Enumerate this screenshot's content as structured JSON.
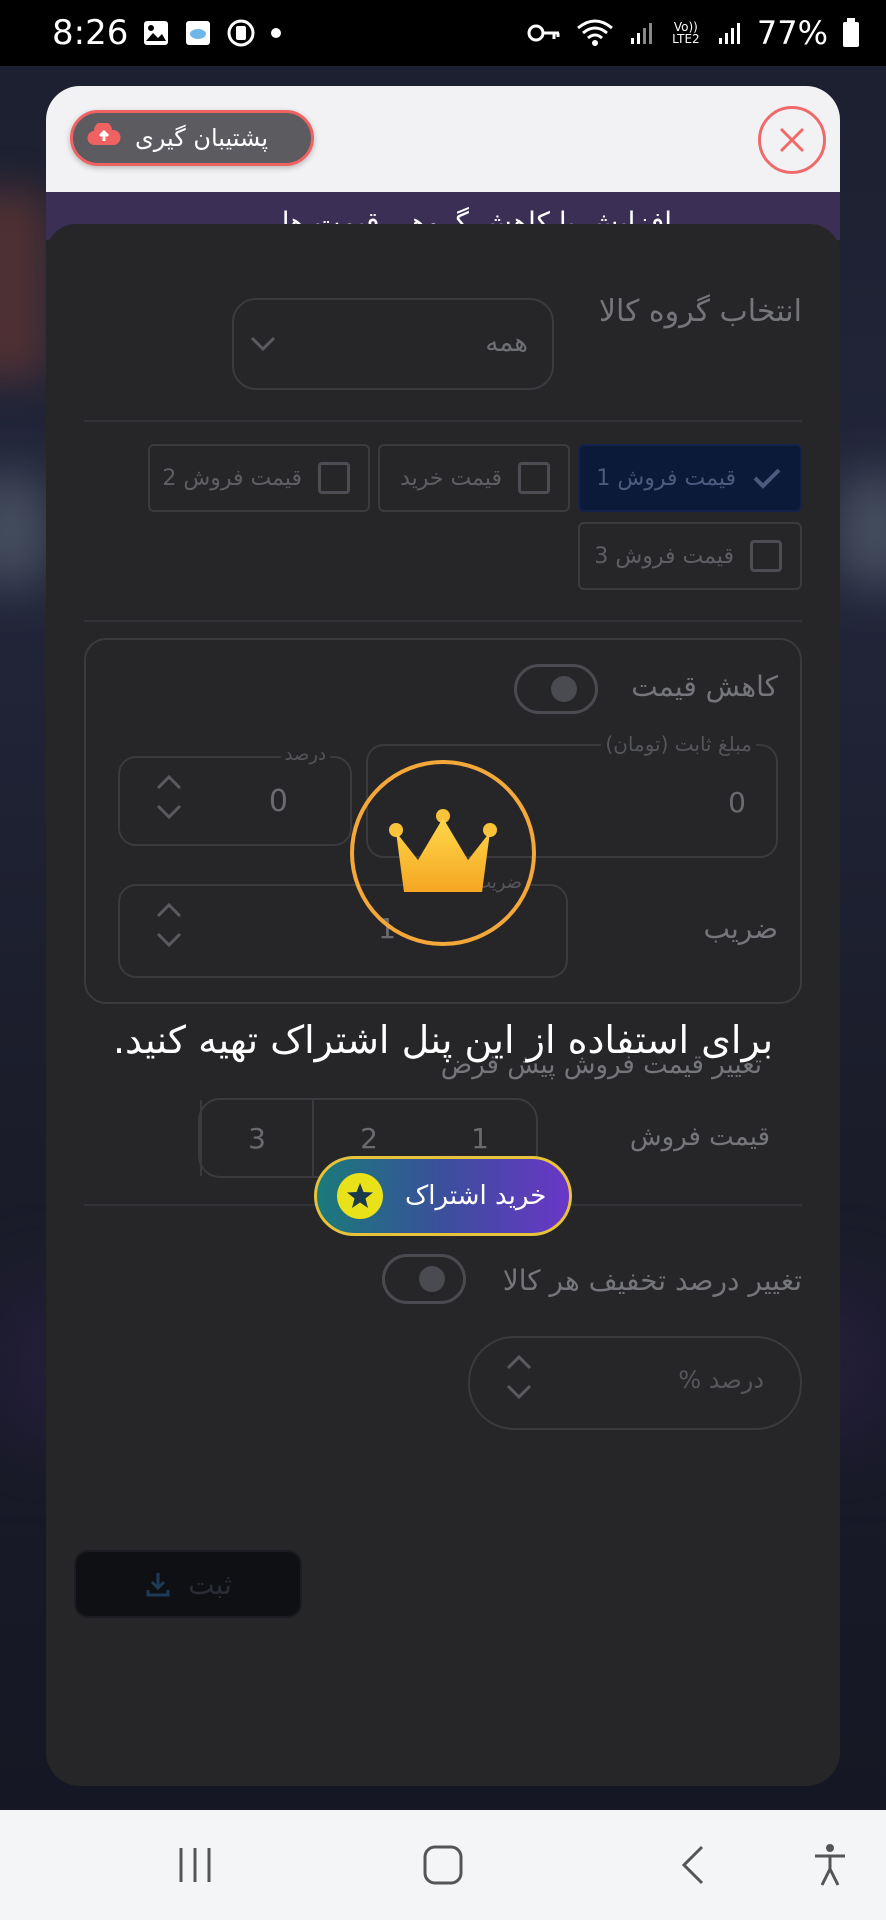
{
  "status_bar": {
    "time": "8:26",
    "battery_percent": "77%",
    "network_label": "Vo)) LTE2"
  },
  "modal": {
    "backup_label": "پشتیبان گیری",
    "title": "افزایش یا کاهش گروهی قیمت ها",
    "accent_close": "#ef6b6b"
  },
  "form": {
    "group_label": "انتخاب گروه کالا",
    "group_value": "همه",
    "price_options": [
      {
        "label": "قیمت فروش 1",
        "checked": true
      },
      {
        "label": "قیمت خرید",
        "checked": false
      },
      {
        "label": "قیمت فروش 2",
        "checked": false
      },
      {
        "label": "قیمت فروش 3",
        "checked": false
      }
    ],
    "decrease_label": "کاهش قیمت",
    "fixed_amount_label": "مبلغ ثابت (تومان)",
    "fixed_amount_value": "0",
    "percent_label": "درصد",
    "percent_value": "0",
    "multiplier_label": "ضریب",
    "multiplier_field_label": "ضریب",
    "multiplier_value": "1",
    "default_price_label": "تغییر قیمت فروش پیش فرض",
    "sale_price_label": "قیمت فروش",
    "sale_options": [
      "1",
      "2",
      "3"
    ],
    "discount_label": "تغییر درصد تخفیف هر کالا",
    "discount_placeholder": "درصد %",
    "submit_label": "ثبت"
  },
  "overlay": {
    "message": "برای استفاده از این پنل اشتراک تهیه کنید.",
    "buy_label": "خرید اشتراک",
    "crown_color": "#f5a83a"
  }
}
